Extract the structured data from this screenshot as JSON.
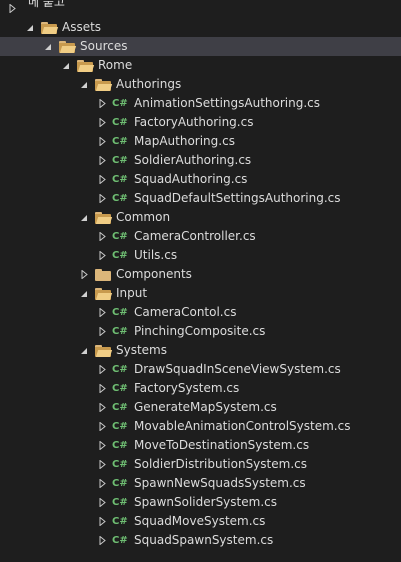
{
  "top_fragment": "메 붙고",
  "tree": [
    {
      "label": "Assets",
      "type": "folder",
      "expanded": true,
      "depth": 1
    },
    {
      "label": "Sources",
      "type": "folder",
      "expanded": true,
      "depth": 2,
      "selected": true
    },
    {
      "label": "Rome",
      "type": "folder",
      "expanded": true,
      "depth": 3
    },
    {
      "label": "Authorings",
      "type": "folder",
      "expanded": true,
      "depth": 4
    },
    {
      "label": "AnimationSettingsAuthoring.cs",
      "type": "cs",
      "depth": 5
    },
    {
      "label": "FactoryAuthoring.cs",
      "type": "cs",
      "depth": 5
    },
    {
      "label": "MapAuthoring.cs",
      "type": "cs",
      "depth": 5
    },
    {
      "label": "SoldierAuthoring.cs",
      "type": "cs",
      "depth": 5
    },
    {
      "label": "SquadAuthoring.cs",
      "type": "cs",
      "depth": 5
    },
    {
      "label": "SquadDefaultSettingsAuthoring.cs",
      "type": "cs",
      "depth": 5
    },
    {
      "label": "Common",
      "type": "folder",
      "expanded": true,
      "depth": 4
    },
    {
      "label": "CameraController.cs",
      "type": "cs",
      "depth": 5
    },
    {
      "label": "Utils.cs",
      "type": "cs",
      "depth": 5
    },
    {
      "label": "Components",
      "type": "folder",
      "expanded": false,
      "depth": 4
    },
    {
      "label": "Input",
      "type": "folder",
      "expanded": true,
      "depth": 4
    },
    {
      "label": "CameraContol.cs",
      "type": "cs",
      "depth": 5
    },
    {
      "label": "PinchingComposite.cs",
      "type": "cs",
      "depth": 5
    },
    {
      "label": "Systems",
      "type": "folder",
      "expanded": true,
      "depth": 4
    },
    {
      "label": "DrawSquadInSceneViewSystem.cs",
      "type": "cs",
      "depth": 5
    },
    {
      "label": "FactorySystem.cs",
      "type": "cs",
      "depth": 5
    },
    {
      "label": "GenerateMapSystem.cs",
      "type": "cs",
      "depth": 5
    },
    {
      "label": "MovableAnimationControlSystem.cs",
      "type": "cs",
      "depth": 5
    },
    {
      "label": "MoveToDestinationSystem.cs",
      "type": "cs",
      "depth": 5
    },
    {
      "label": "SoldierDistributionSystem.cs",
      "type": "cs",
      "depth": 5
    },
    {
      "label": "SpawnNewSquadsSystem.cs",
      "type": "cs",
      "depth": 5
    },
    {
      "label": "SpawnSoliderSystem.cs",
      "type": "cs",
      "depth": 5
    },
    {
      "label": "SquadMoveSystem.cs",
      "type": "cs",
      "depth": 5
    },
    {
      "label": "SquadSpawnSystem.cs",
      "type": "cs",
      "depth": 5
    }
  ],
  "cs_badge": "C#",
  "colors": {
    "background": "#1e1e1e",
    "selected_row": "#3f3f46",
    "text": "#dcdcdc",
    "folder": "#dcb67a",
    "csharp_badge": "#6fbf73"
  }
}
